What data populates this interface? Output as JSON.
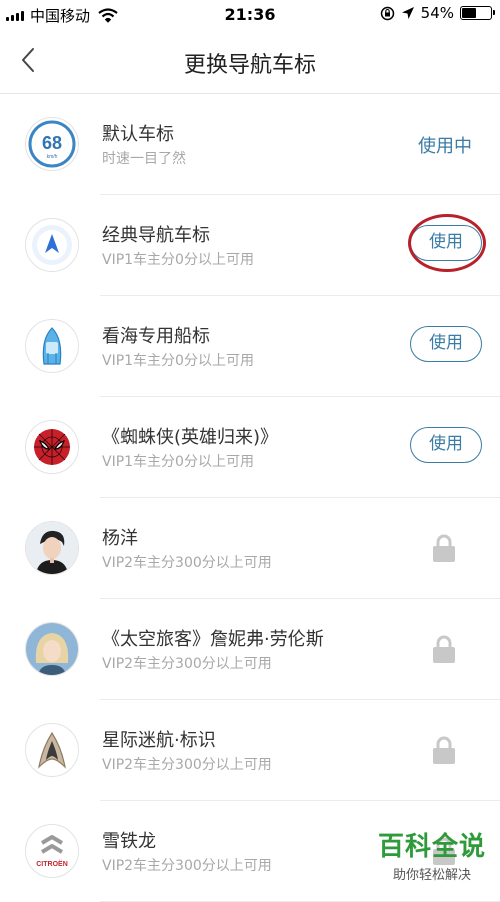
{
  "status_bar": {
    "carrier": "中国移动",
    "time": "21:36",
    "battery": "54%",
    "battery_level": 0.54
  },
  "header": {
    "title": "更换导航车标"
  },
  "items": [
    {
      "name": "默认车标",
      "sub": "时速一目了然",
      "action": "in_use",
      "action_label": "使用中",
      "icon": "speed-68-icon",
      "speed_value": "68",
      "speed_unit": "km/h"
    },
    {
      "name": "经典导航车标",
      "sub": "VIP1车主分0分以上可用",
      "action": "use",
      "action_label": "使用",
      "icon": "navigation-arrow-icon",
      "highlighted": true
    },
    {
      "name": "看海专用船标",
      "sub": "VIP1车主分0分以上可用",
      "action": "use",
      "action_label": "使用",
      "icon": "boat-icon"
    },
    {
      "name": "《蜘蛛侠(英雄归来)》",
      "sub": "VIP1车主分0分以上可用",
      "action": "use",
      "action_label": "使用",
      "icon": "spiderman-icon"
    },
    {
      "name": "杨洋",
      "sub": "VIP2车主分300分以上可用",
      "action": "locked",
      "icon": "portrait-icon"
    },
    {
      "name": "《太空旅客》詹妮弗·劳伦斯",
      "sub": "VIP2车主分300分以上可用",
      "action": "locked",
      "icon": "portrait-icon"
    },
    {
      "name": "星际迷航·标识",
      "sub": "VIP2车主分300分以上可用",
      "action": "locked",
      "icon": "star-trek-badge-icon"
    },
    {
      "name": "雪铁龙",
      "sub": "VIP2车主分300分以上可用",
      "action": "locked",
      "icon": "citroen-logo-icon",
      "logo_text": "CITROËN"
    }
  ],
  "watermark": {
    "title": "百科全说",
    "subtitle": "助你轻松解决"
  },
  "colors": {
    "accent": "#3a7ca5",
    "annotation_ring": "#b8202a",
    "watermark_green": "#2e9a3a"
  }
}
